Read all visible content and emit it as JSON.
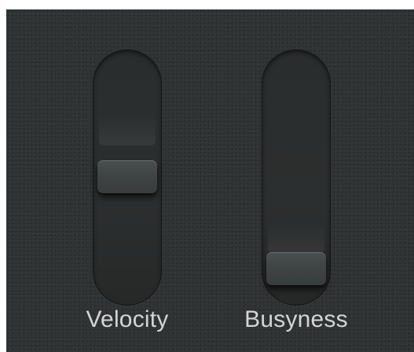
{
  "sliders": [
    {
      "label": "Velocity",
      "level_percent": 58
    },
    {
      "label": "Busyness",
      "level_percent": 7
    }
  ],
  "colors": {
    "panel_background": "#313434",
    "track": "#2c2f2f",
    "thumb": "#3f4444",
    "label_text": "#d4d6d6"
  }
}
